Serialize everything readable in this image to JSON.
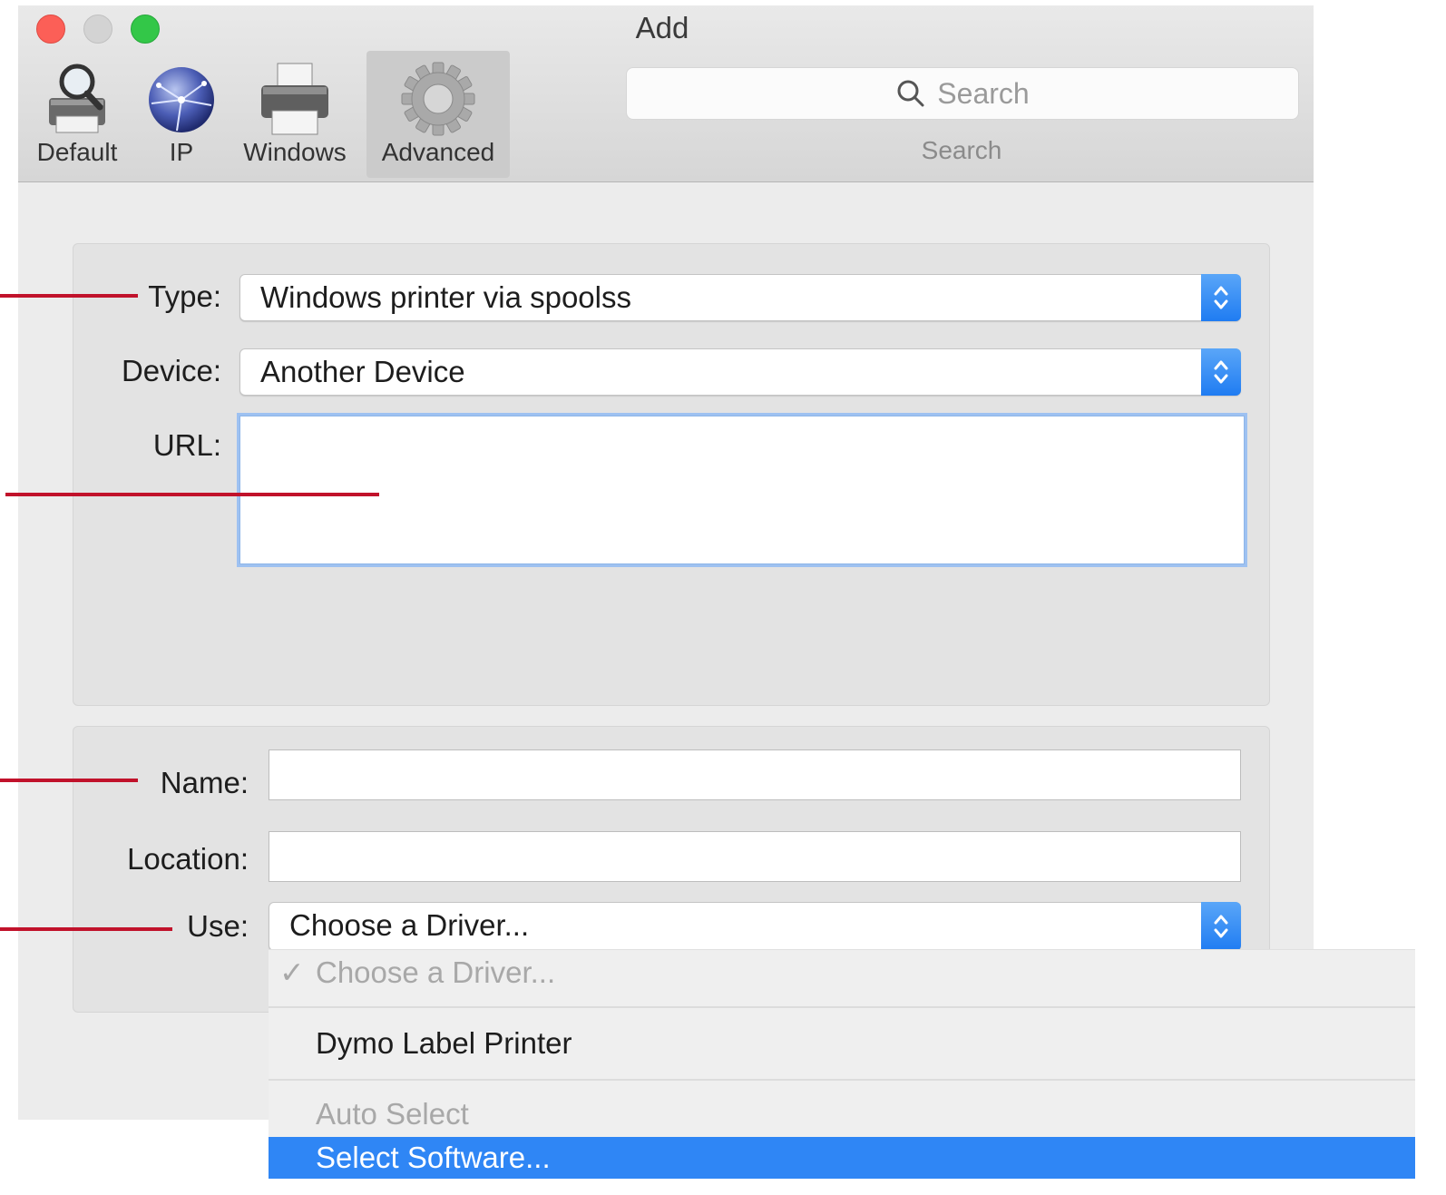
{
  "window": {
    "title": "Add"
  },
  "toolbar": {
    "items": [
      {
        "label": "Default",
        "icon": "printer-search-icon"
      },
      {
        "label": "IP",
        "icon": "globe-network-icon"
      },
      {
        "label": "Windows",
        "icon": "printer-icon"
      },
      {
        "label": "Advanced",
        "icon": "gear-icon",
        "active": true
      }
    ],
    "search": {
      "placeholder": "Search",
      "caption": "Search"
    }
  },
  "connection": {
    "type_label": "Type:",
    "type_value": "Windows printer via spoolss",
    "device_label": "Device:",
    "device_value": "Another Device",
    "url_label": "URL:",
    "url_value": ""
  },
  "details": {
    "name_label": "Name:",
    "name_value": "",
    "location_label": "Location:",
    "location_value": "",
    "use_label": "Use:",
    "use_value": "Choose a Driver..."
  },
  "use_menu": {
    "items": [
      {
        "label": "Choose a Driver...",
        "checked": true,
        "disabled": true
      },
      {
        "label": "Dymo Label Printer"
      },
      {
        "label": "Auto Select",
        "disabled": true
      },
      {
        "label": "Select Software...",
        "highlighted": true
      }
    ]
  },
  "colors": {
    "annotation": "#c1122b",
    "selection": "#2f86f5",
    "stepper": "#1f7cf2"
  }
}
